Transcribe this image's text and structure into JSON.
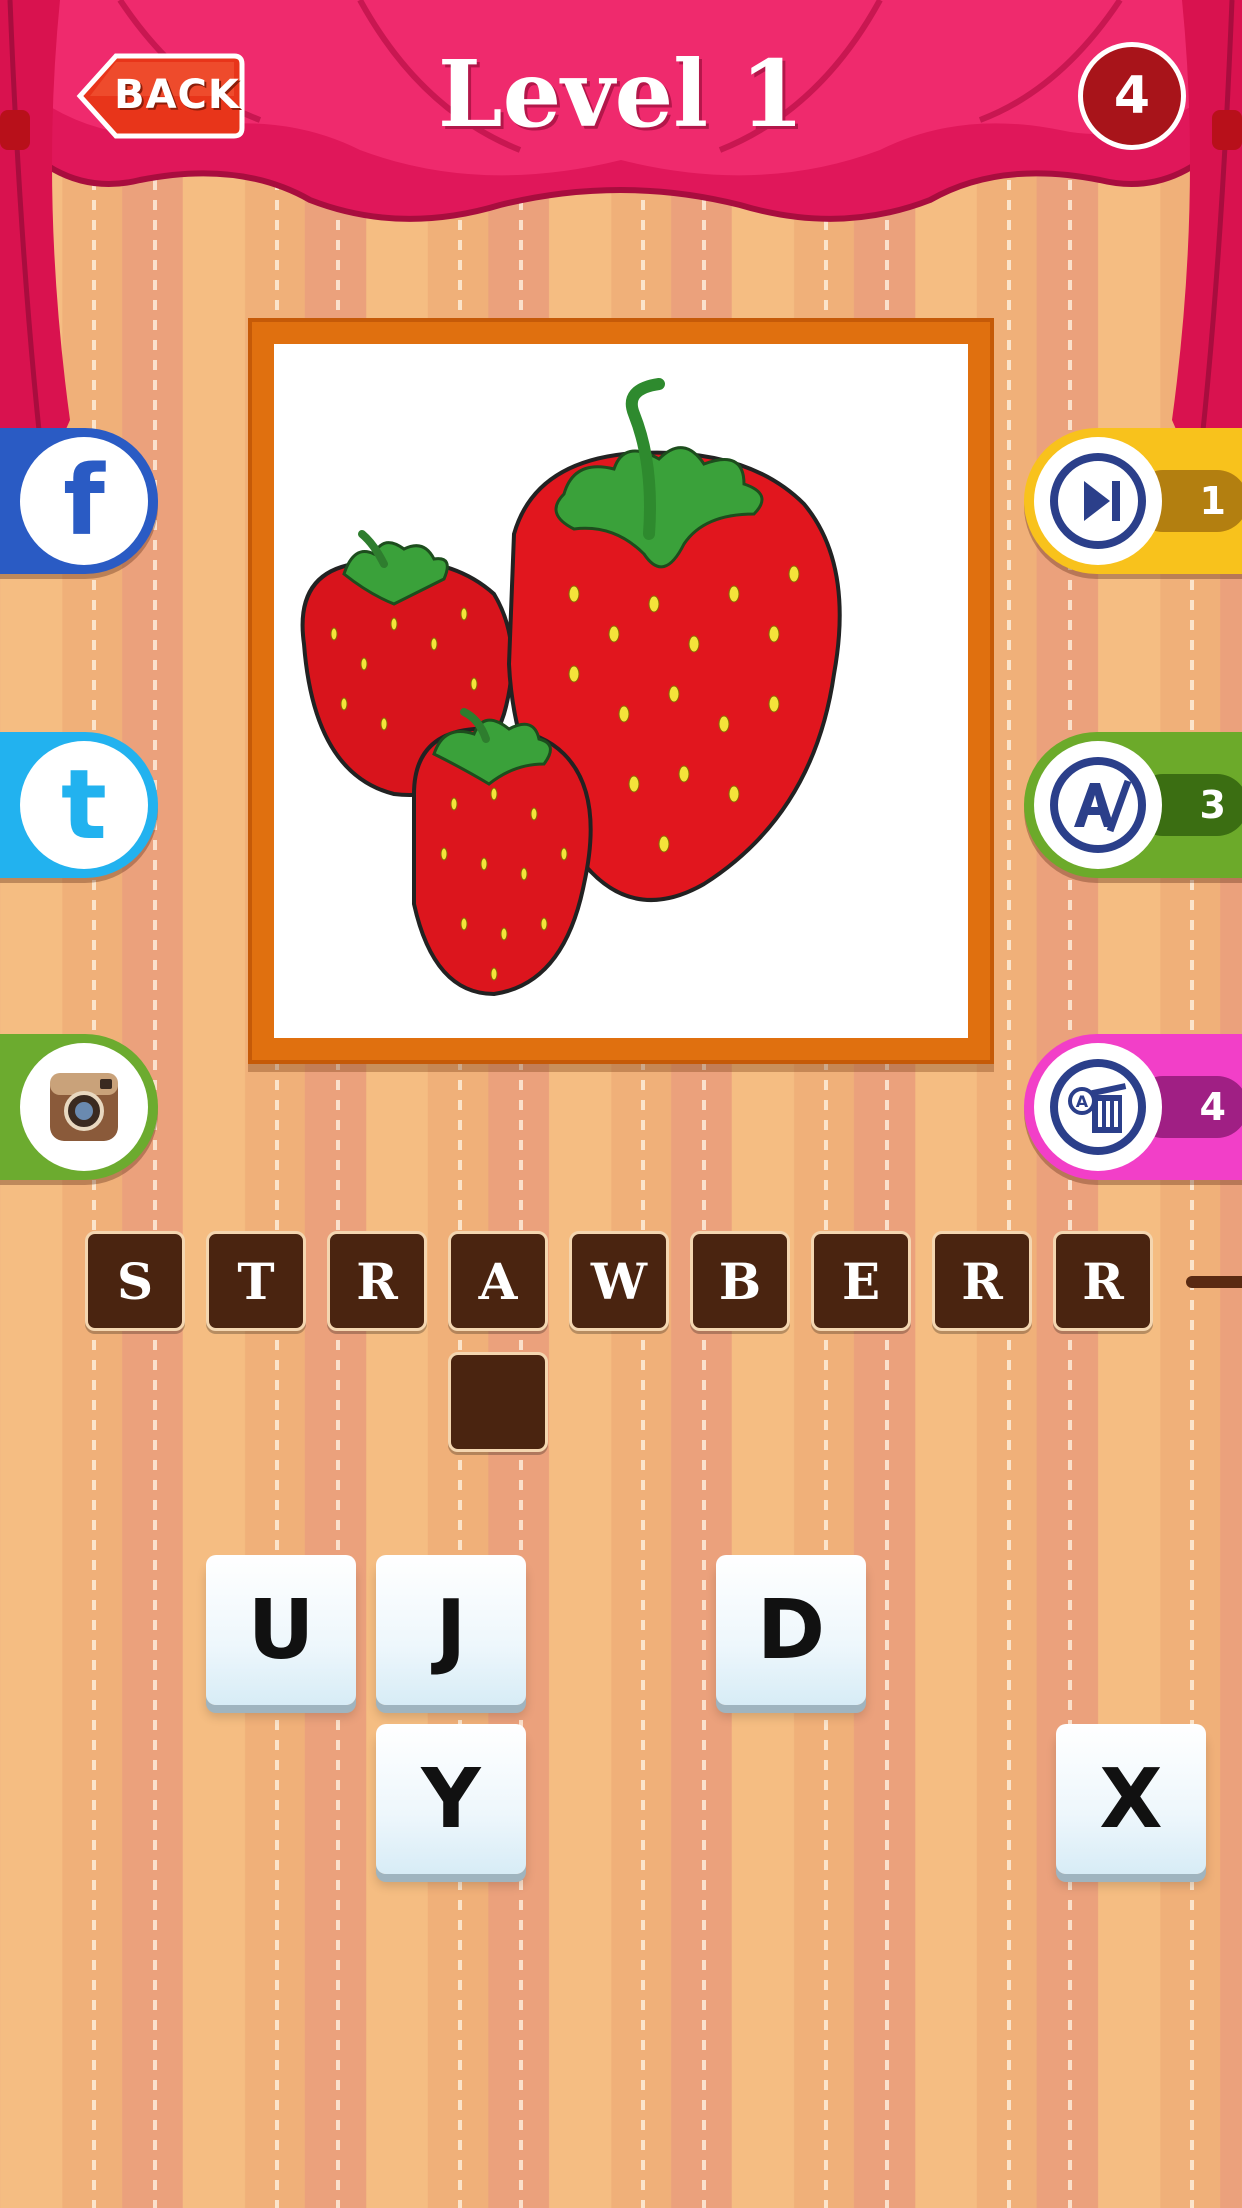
{
  "header": {
    "back_label": "BACK",
    "title": "Level 1",
    "coins": "4"
  },
  "puzzle": {
    "image_subject": "strawberries",
    "answer_slots": [
      "S",
      "T",
      "R",
      "A",
      "W",
      "B",
      "E",
      "R",
      "R",
      ""
    ]
  },
  "social": {
    "facebook_glyph": "f",
    "twitter_glyph": "t"
  },
  "hints": {
    "skip_count": "1",
    "reveal_count": "3",
    "remove_count": "4"
  },
  "letter_tiles": [
    "U",
    "J",
    "D",
    "Y",
    "X"
  ],
  "colors": {
    "curtain": "#e0175a",
    "frame": "#e0700f",
    "slot": "#4a2410",
    "facebook": "#2a5bc4",
    "twitter": "#22b2ef",
    "instagram": "#6cab2f",
    "skip": "#f8c21c",
    "reveal": "#6caa2a",
    "remove": "#f23fc8"
  }
}
